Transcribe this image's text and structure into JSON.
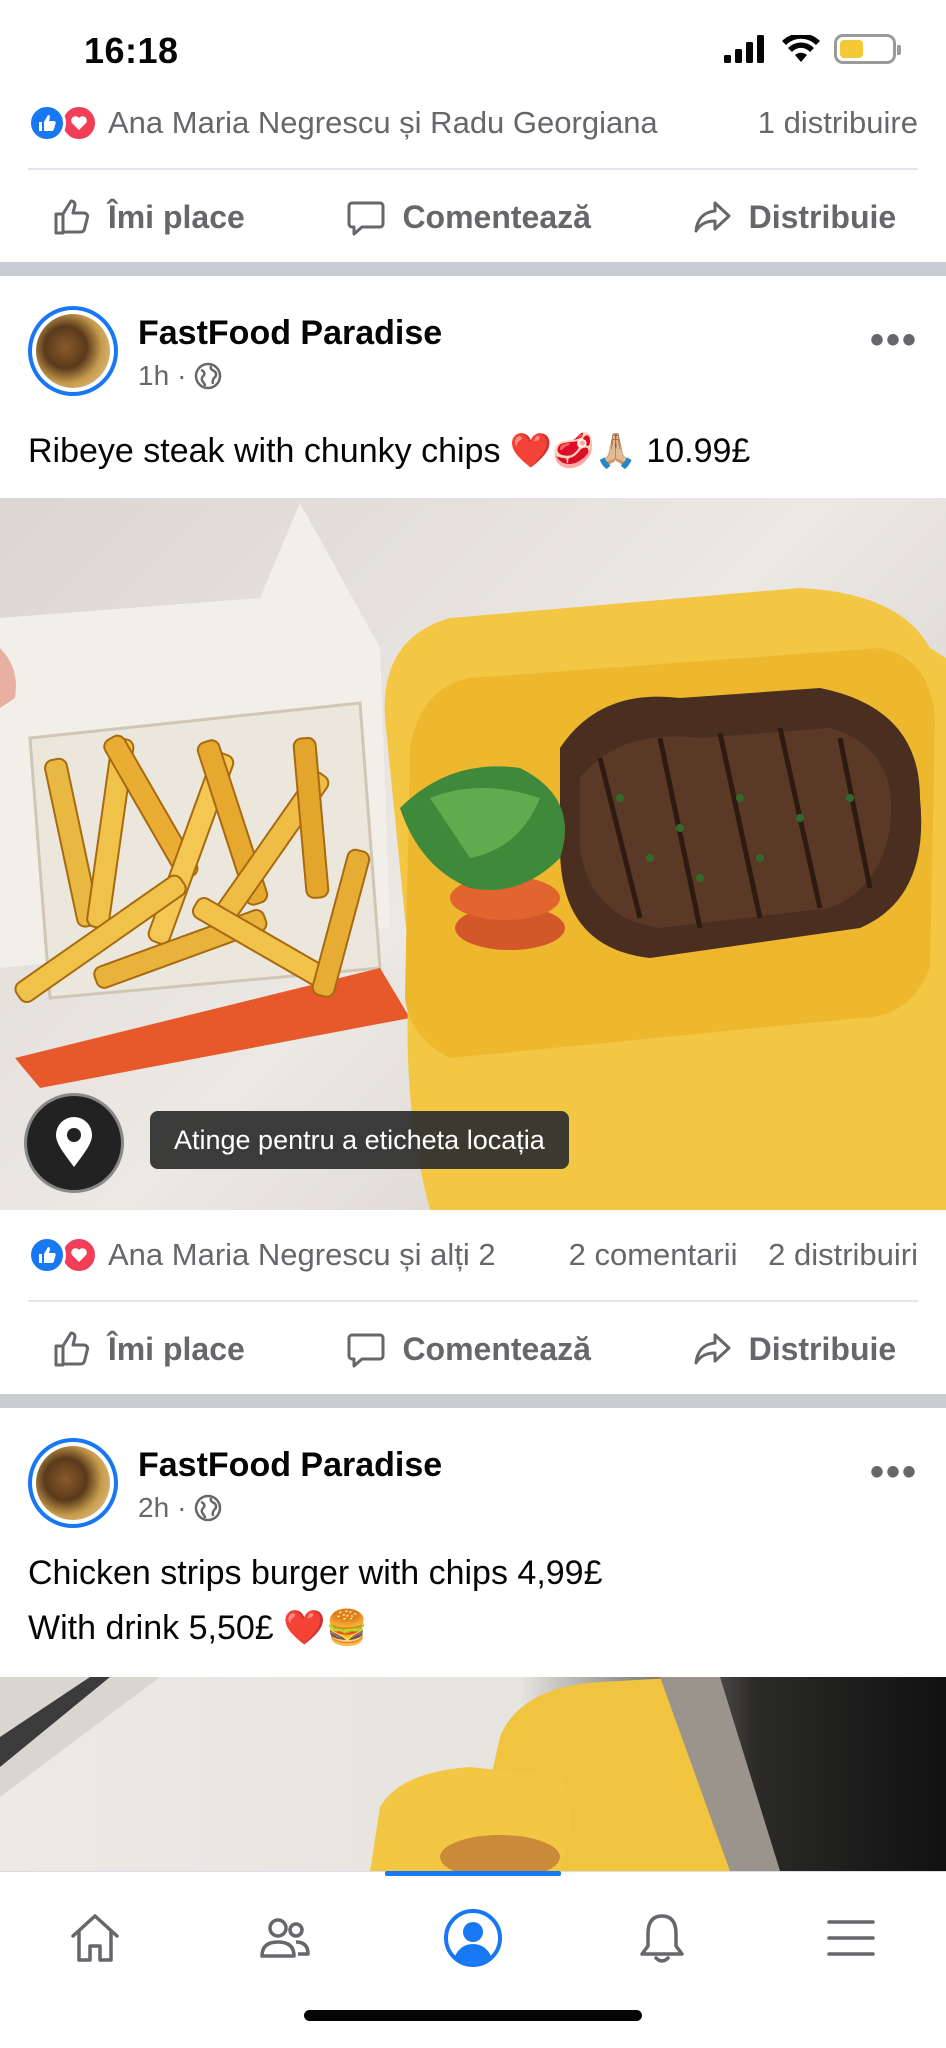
{
  "status_bar": {
    "time": "16:18"
  },
  "colors": {
    "brand_blue": "#1877f2",
    "love_red": "#f33e58",
    "battery_yellow": "#f5c935"
  },
  "prev_post": {
    "reactions_text": "Ana Maria Negrescu și Radu Georgiana",
    "shares": "1 distribuire"
  },
  "actions": {
    "like": "Îmi place",
    "comment": "Comentează",
    "share": "Distribuie"
  },
  "post1": {
    "author": "FastFood Paradise",
    "time": "1h",
    "text": "Ribeye steak with chunky chips ❤️🥩🙏🏼 10.99£",
    "location_tip": "Atinge pentru a eticheta locația",
    "reactions_text": "Ana Maria Negrescu și alți 2",
    "comments": "2 comentarii",
    "shares": "2 distribuiri"
  },
  "post2": {
    "author": "FastFood Paradise",
    "time": "2h",
    "text_line1": "Chicken strips burger with chips 4,99£",
    "text_line2": "With drink 5,50£ ❤️🍔"
  },
  "icons": {
    "status": [
      "signal-icon",
      "wifi-icon",
      "battery-icon"
    ],
    "tabs": [
      "home-icon",
      "friends-icon",
      "profile-icon",
      "bell-icon",
      "menu-icon"
    ]
  }
}
